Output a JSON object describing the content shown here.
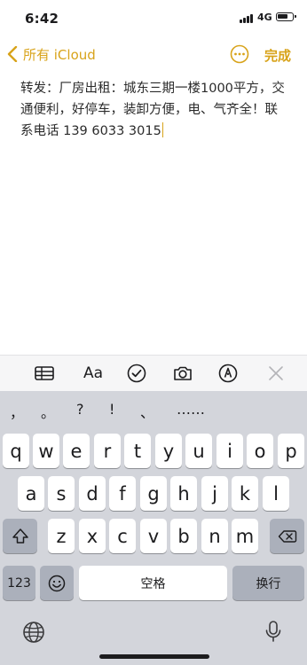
{
  "status": {
    "time": "6:42",
    "network": "4G"
  },
  "nav": {
    "back_label": "所有 iCloud",
    "done_label": "完成"
  },
  "note": {
    "text": "转发：厂房出租：城东三期一楼1000平方，交通便利，好停车，装卸方便，电、气齐全！联系电话 139 6033 3015"
  },
  "toolbar": {
    "format_label": "Aa"
  },
  "keyboard": {
    "candidates": [
      "，",
      "。",
      "?",
      "!",
      "、",
      "……"
    ],
    "row1": [
      "q",
      "w",
      "e",
      "r",
      "t",
      "y",
      "u",
      "i",
      "o",
      "p"
    ],
    "row2": [
      "a",
      "s",
      "d",
      "f",
      "g",
      "h",
      "j",
      "k",
      "l"
    ],
    "row3": [
      "z",
      "x",
      "c",
      "v",
      "b",
      "n",
      "m"
    ],
    "numbers_label": "123",
    "space_label": "空格",
    "return_label": "换行"
  },
  "colors": {
    "accent": "#d8a31a",
    "keyboard_bg": "#d3d5db",
    "key": "#ffffff",
    "dark_key": "#abb0bb"
  }
}
